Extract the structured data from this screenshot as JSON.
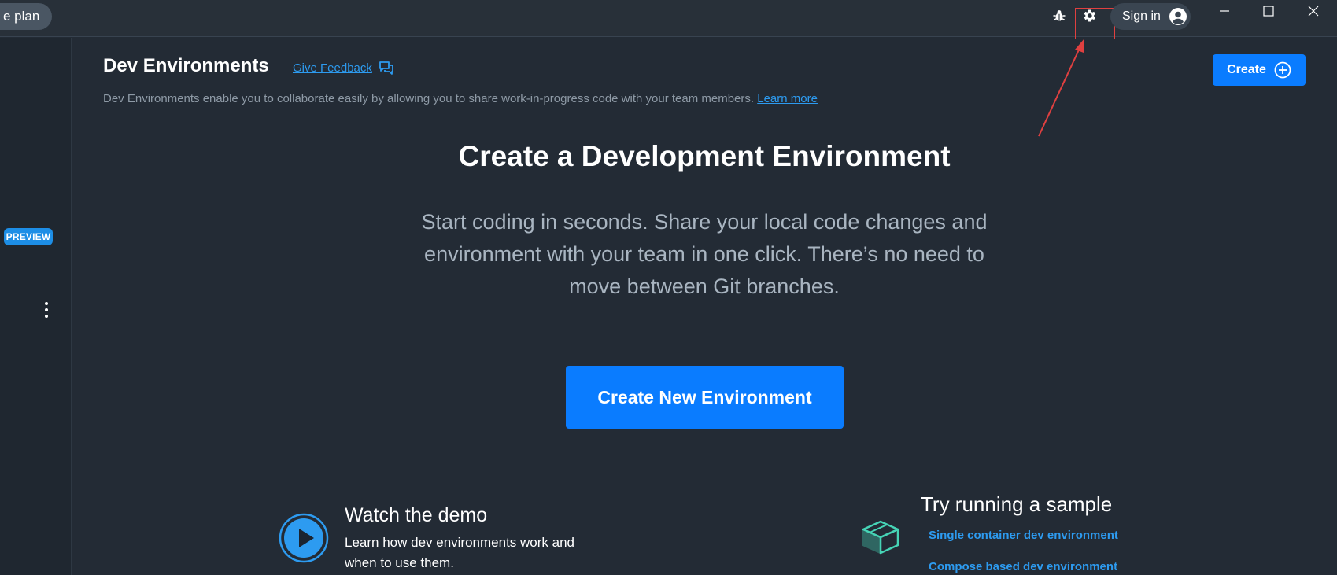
{
  "titlebar": {
    "plan_label": "e plan",
    "signin_label": "Sign in"
  },
  "sidebar": {
    "preview_badge": "PREVIEW"
  },
  "header": {
    "title": "Dev Environments",
    "feedback_label": "Give Feedback",
    "subtitle": "Dev Environments enable you to collaborate easily by allowing you to share work-in-progress code with your team members.",
    "learn_more": "Learn more",
    "create_label": "Create"
  },
  "hero": {
    "title": "Create a Development Environment",
    "description": "Start coding in seconds. Share your local code changes and environment with your team in one click. There’s no need to move between Git branches.",
    "cta_label": "Create New Environment"
  },
  "demo": {
    "title": "Watch the demo",
    "description": "Learn how dev environments work and when to use them."
  },
  "samples": {
    "title": "Try running a sample",
    "links": [
      "Single container dev environment",
      "Compose based dev environment"
    ]
  },
  "icons": {
    "bug": "bug-icon",
    "gear": "gear-icon",
    "account": "account-circle-icon",
    "chat": "chat-bubbles-icon",
    "plus": "plus-circle-icon",
    "play": "play-circle-icon",
    "sample": "cube-icon"
  },
  "colors": {
    "background": "#232b35",
    "titlebar": "#283039",
    "sidebar": "#1f2730",
    "accent": "#0a7cff",
    "link": "#2d9bf0",
    "muted_text": "#8e9aa6",
    "annotation": "#e04040"
  }
}
